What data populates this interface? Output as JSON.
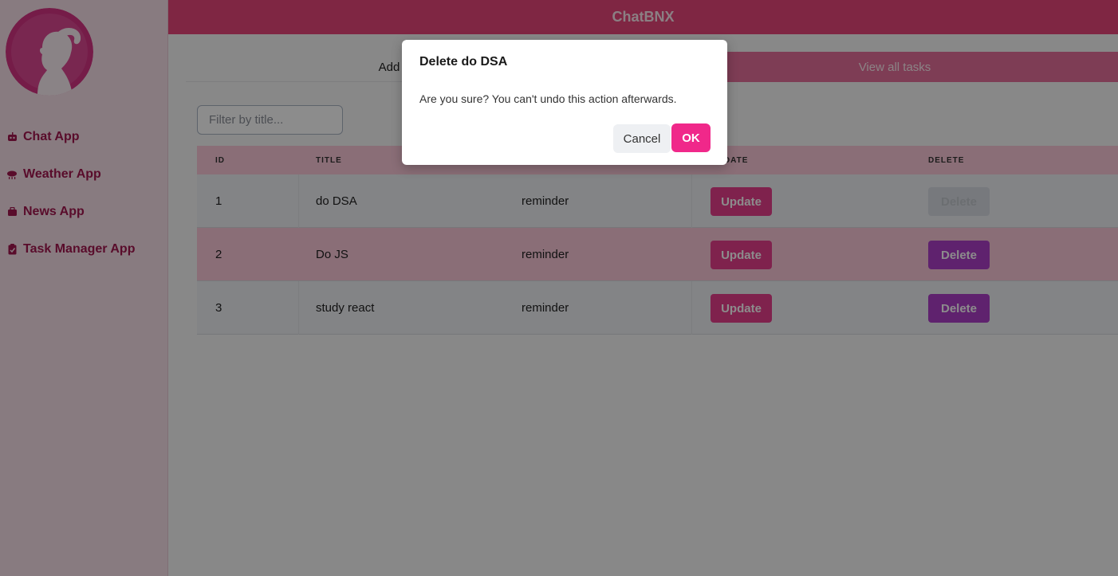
{
  "header": {
    "title": "ChatBNX"
  },
  "sidebar": {
    "items": [
      {
        "label": "Chat App",
        "icon": "robot-icon"
      },
      {
        "label": "Weather App",
        "icon": "cloud-rain-icon"
      },
      {
        "label": "News App",
        "icon": "newspaper-icon"
      },
      {
        "label": "Task Manager App",
        "icon": "clipboard-check-icon"
      }
    ]
  },
  "tabs": {
    "add": "Add",
    "view": "View all tasks"
  },
  "filter": {
    "placeholder": "Filter by title..."
  },
  "table": {
    "headers": [
      "ID",
      "TITLE",
      "",
      "UPDATE",
      "DELETE"
    ],
    "rows": [
      {
        "id": "1",
        "title": "do DSA",
        "type": "reminder",
        "update": "Update",
        "delete": "Delete",
        "delete_disabled": true
      },
      {
        "id": "2",
        "title": "Do JS",
        "type": "reminder",
        "update": "Update",
        "delete": "Delete",
        "delete_disabled": false
      },
      {
        "id": "3",
        "title": "study react",
        "type": "reminder",
        "update": "Update",
        "delete": "Delete",
        "delete_disabled": false
      }
    ]
  },
  "modal": {
    "title": "Delete do DSA",
    "body": "Are you sure? You can't undo this action afterwards.",
    "cancel": "Cancel",
    "ok": "OK"
  },
  "colors": {
    "header": "#e7457a",
    "sidebar_text": "#a3174f",
    "update_button": "#e83e8c",
    "delete_button": "#ae3ec9",
    "ok_button": "#f0288a"
  }
}
